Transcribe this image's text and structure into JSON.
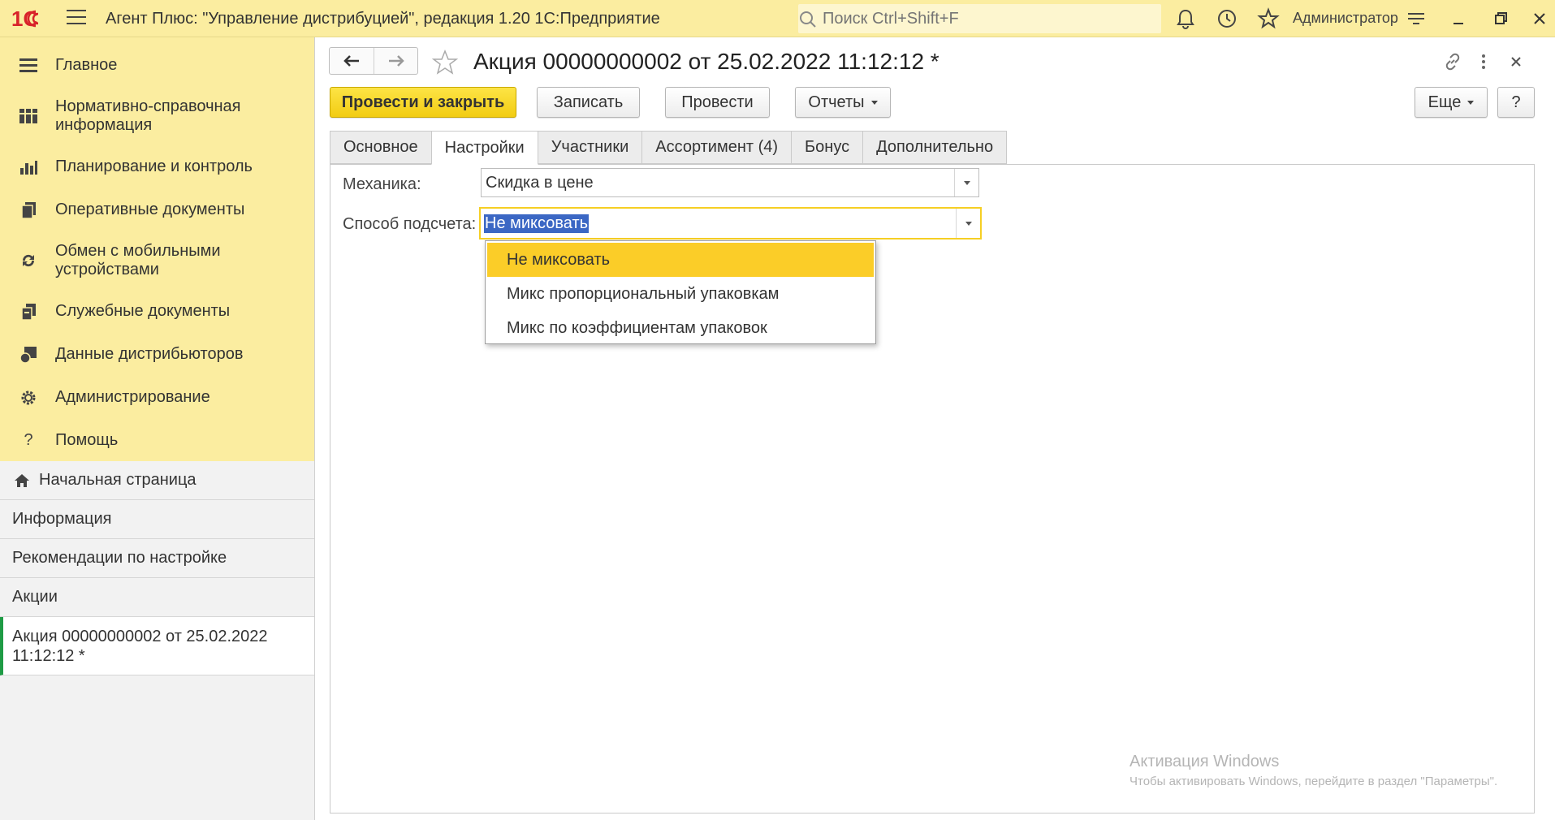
{
  "window": {
    "title": "Агент Плюс: \"Управление дистрибуцией\", редакция 1.20 1С:Предприятие",
    "search_placeholder": "Поиск Ctrl+Shift+F",
    "user": "Администратор",
    "logo_text": "1С"
  },
  "sidebar": {
    "sections": [
      {
        "label": "Главное",
        "icon": "menu-lines-icon"
      },
      {
        "label": "Нормативно-справочная информация",
        "icon": "reference-grid-icon"
      },
      {
        "label": "Планирование и контроль",
        "icon": "bar-chart-icon"
      },
      {
        "label": "Оперативные документы",
        "icon": "documents-icon"
      },
      {
        "label": "Обмен с мобильными устройствами",
        "icon": "sync-icon"
      },
      {
        "label": "Служебные документы",
        "icon": "service-documents-icon"
      },
      {
        "label": "Данные дистрибьюторов",
        "icon": "distributor-data-icon"
      },
      {
        "label": "Администрирование",
        "icon": "gear-icon"
      },
      {
        "label": "Помощь",
        "icon": "question-icon"
      }
    ],
    "open_windows": [
      {
        "label": "Начальная страница"
      },
      {
        "label": "Информация"
      },
      {
        "label": "Рекомендации по настройке"
      },
      {
        "label": "Акции"
      },
      {
        "label": "Акция 00000000002 от 25.02.2022 11:12:12 *"
      }
    ]
  },
  "document": {
    "title": "Акция 00000000002 от 25.02.2022 11:12:12 *",
    "buttons": {
      "post_close": "Провести и закрыть",
      "save": "Записать",
      "post": "Провести",
      "reports": "Отчеты",
      "more": "Еще",
      "help": "?"
    },
    "tabs": [
      {
        "label": "Основное",
        "active": false
      },
      {
        "label": "Настройки",
        "active": true
      },
      {
        "label": "Участники",
        "active": false
      },
      {
        "label": "Ассортимент (4)",
        "active": false
      },
      {
        "label": "Бонус",
        "active": false
      },
      {
        "label": "Дополнительно",
        "active": false
      }
    ],
    "fields": {
      "mechanics": {
        "label": "Механика:",
        "value": "Скидка в цене"
      },
      "calc_method": {
        "label": "Способ подсчета:",
        "value": "Не миксовать"
      }
    },
    "dropdown_options": [
      {
        "label": "Не миксовать",
        "highlighted": true
      },
      {
        "label": "Микс пропорциональный упаковкам",
        "highlighted": false
      },
      {
        "label": "Микс по коэффициентам упаковок",
        "highlighted": false
      }
    ]
  },
  "watermark": {
    "line1": "Активация Windows",
    "line2": "Чтобы активировать Windows, перейдите в раздел \"Параметры\"."
  },
  "colors": {
    "accent_yellow": "#fbeda0",
    "primary_button": "#f2cc13",
    "highlight_option": "#fbcd28",
    "active_marker": "#1f9b45",
    "selection_blue": "#3b67c4",
    "logo_red": "#d8232a"
  }
}
